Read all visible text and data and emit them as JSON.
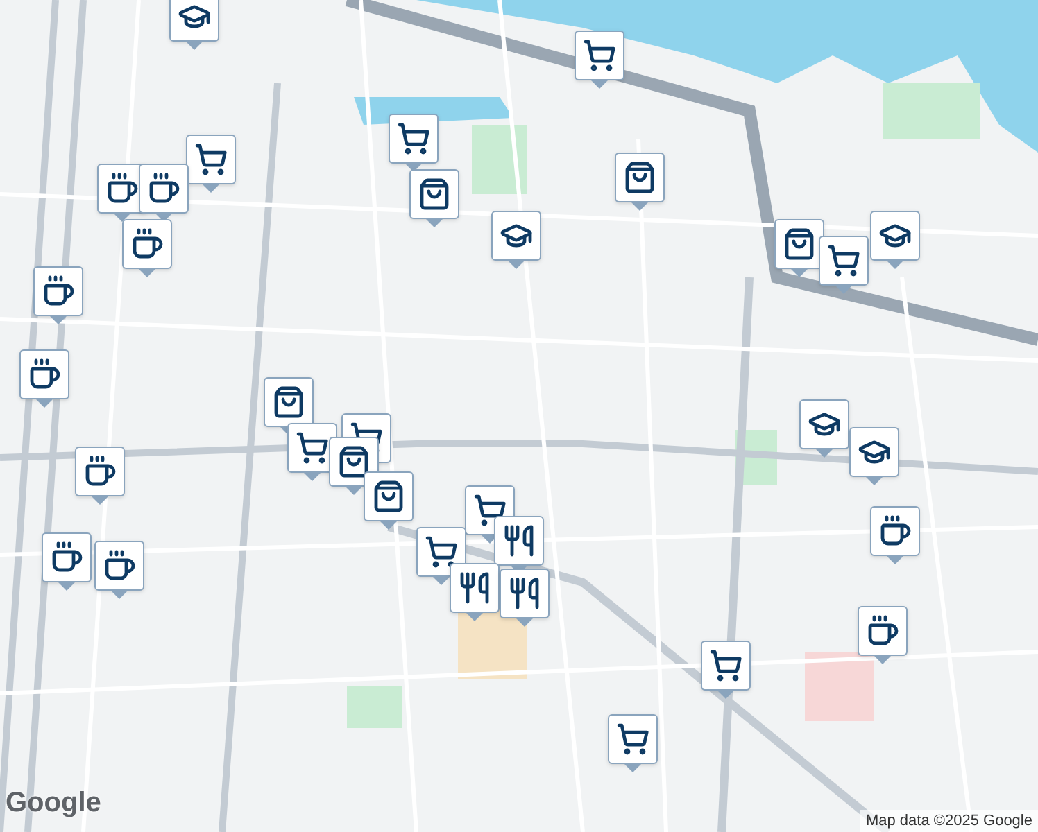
{
  "map": {
    "markers": [
      {
        "kind": "school"
      },
      {
        "kind": "cart"
      },
      {
        "kind": "cart"
      },
      {
        "kind": "cart"
      },
      {
        "kind": "coffee"
      },
      {
        "kind": "coffee"
      },
      {
        "kind": "bag"
      },
      {
        "kind": "bag"
      },
      {
        "kind": "school"
      },
      {
        "kind": "coffee"
      },
      {
        "kind": "bag"
      },
      {
        "kind": "cart"
      },
      {
        "kind": "school"
      },
      {
        "kind": "coffee"
      },
      {
        "kind": "coffee"
      },
      {
        "kind": "bag"
      },
      {
        "kind": "cart"
      },
      {
        "kind": "cart"
      },
      {
        "kind": "bag"
      },
      {
        "kind": "coffee"
      },
      {
        "kind": "school"
      },
      {
        "kind": "school"
      },
      {
        "kind": "bag"
      },
      {
        "kind": "cart"
      },
      {
        "kind": "food"
      },
      {
        "kind": "cart"
      },
      {
        "kind": "food"
      },
      {
        "kind": "food"
      },
      {
        "kind": "coffee"
      },
      {
        "kind": "coffee"
      },
      {
        "kind": "coffee"
      },
      {
        "kind": "coffee"
      },
      {
        "kind": "cart"
      },
      {
        "kind": "cart"
      }
    ]
  },
  "logo": "Google",
  "attribution": "Map data ©2025 Google"
}
